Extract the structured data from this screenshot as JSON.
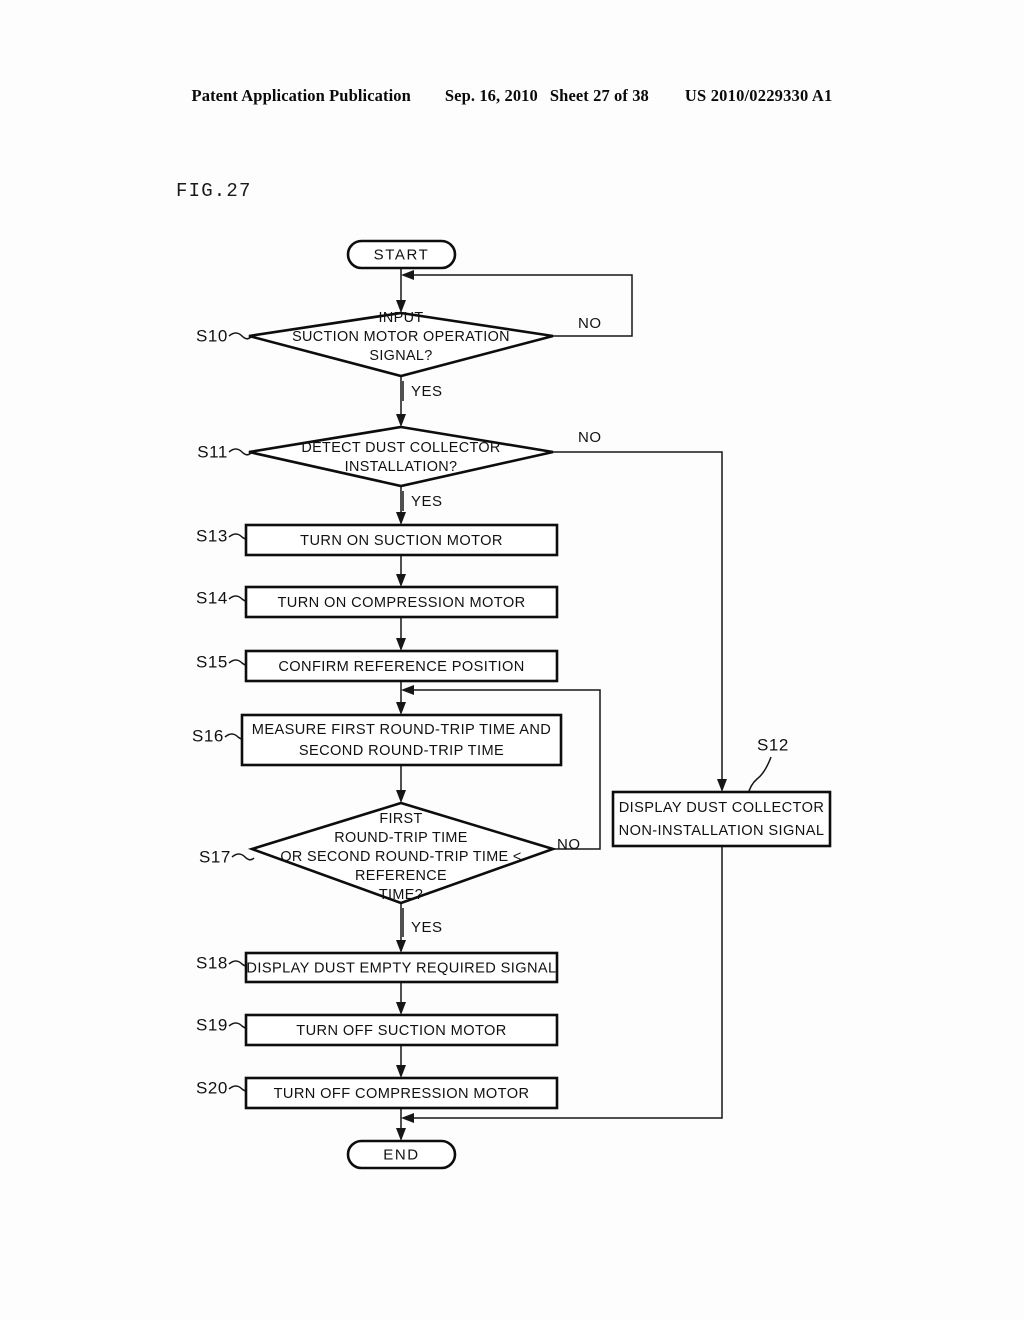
{
  "header": {
    "publication": "Patent Application Publication",
    "date": "Sep. 16, 2010",
    "sheet": "Sheet 27 of 38",
    "doc_number": "US 2010/0229330 A1"
  },
  "figure": {
    "label": "FIG.27"
  },
  "chart_data": {
    "type": "diagram",
    "diagram_type": "flowchart",
    "title": "FIG.27",
    "nodes": [
      {
        "id": "start",
        "shape": "terminator",
        "step": "",
        "lines": [
          "START"
        ]
      },
      {
        "id": "s10",
        "shape": "decision",
        "step": "S10",
        "lines": [
          "INPUT",
          "SUCTION MOTOR OPERATION",
          "SIGNAL?"
        ]
      },
      {
        "id": "s11",
        "shape": "decision",
        "step": "S11",
        "lines": [
          "DETECT DUST COLLECTOR",
          "INSTALLATION?"
        ]
      },
      {
        "id": "s13",
        "shape": "process",
        "step": "S13",
        "lines": [
          "TURN ON SUCTION MOTOR"
        ]
      },
      {
        "id": "s14",
        "shape": "process",
        "step": "S14",
        "lines": [
          "TURN ON COMPRESSION MOTOR"
        ]
      },
      {
        "id": "s15",
        "shape": "process",
        "step": "S15",
        "lines": [
          "CONFIRM REFERENCE POSITION"
        ]
      },
      {
        "id": "s16",
        "shape": "process",
        "step": "S16",
        "lines": [
          "MEASURE FIRST ROUND-TRIP TIME AND",
          "SECOND ROUND-TRIP TIME"
        ]
      },
      {
        "id": "s17",
        "shape": "decision",
        "step": "S17",
        "lines": [
          "FIRST",
          "ROUND-TRIP TIME",
          "OR SECOND ROUND-TRIP TIME <",
          "REFERENCE",
          "TIME?"
        ]
      },
      {
        "id": "s12",
        "shape": "process",
        "step": "S12",
        "lines": [
          "DISPLAY DUST COLLECTOR",
          "NON-INSTALLATION SIGNAL"
        ]
      },
      {
        "id": "s18",
        "shape": "process",
        "step": "S18",
        "lines": [
          "DISPLAY DUST EMPTY REQUIRED SIGNAL"
        ]
      },
      {
        "id": "s19",
        "shape": "process",
        "step": "S19",
        "lines": [
          "TURN OFF SUCTION MOTOR"
        ]
      },
      {
        "id": "s20",
        "shape": "process",
        "step": "S20",
        "lines": [
          "TURN OFF COMPRESSION MOTOR"
        ]
      },
      {
        "id": "end",
        "shape": "terminator",
        "step": "",
        "lines": [
          "END"
        ]
      }
    ],
    "branch_labels": {
      "s10_yes": "YES",
      "s10_no": "NO",
      "s11_yes": "YES",
      "s11_no": "NO",
      "s17_yes": "YES",
      "s17_no": "NO"
    },
    "edges": [
      {
        "from": "start",
        "to": "s10",
        "label": ""
      },
      {
        "from": "s10",
        "to": "s11",
        "label": "YES"
      },
      {
        "from": "s10",
        "to": "s10",
        "label": "NO"
      },
      {
        "from": "s11",
        "to": "s13",
        "label": "YES"
      },
      {
        "from": "s11",
        "to": "s12",
        "label": "NO"
      },
      {
        "from": "s13",
        "to": "s14",
        "label": ""
      },
      {
        "from": "s14",
        "to": "s15",
        "label": ""
      },
      {
        "from": "s15",
        "to": "s16",
        "label": ""
      },
      {
        "from": "s16",
        "to": "s17",
        "label": ""
      },
      {
        "from": "s17",
        "to": "s18",
        "label": "YES"
      },
      {
        "from": "s17",
        "to": "s16",
        "label": "NO"
      },
      {
        "from": "s18",
        "to": "s19",
        "label": ""
      },
      {
        "from": "s19",
        "to": "s20",
        "label": ""
      },
      {
        "from": "s20",
        "to": "end",
        "label": ""
      },
      {
        "from": "s12",
        "to": "end",
        "label": ""
      }
    ]
  }
}
